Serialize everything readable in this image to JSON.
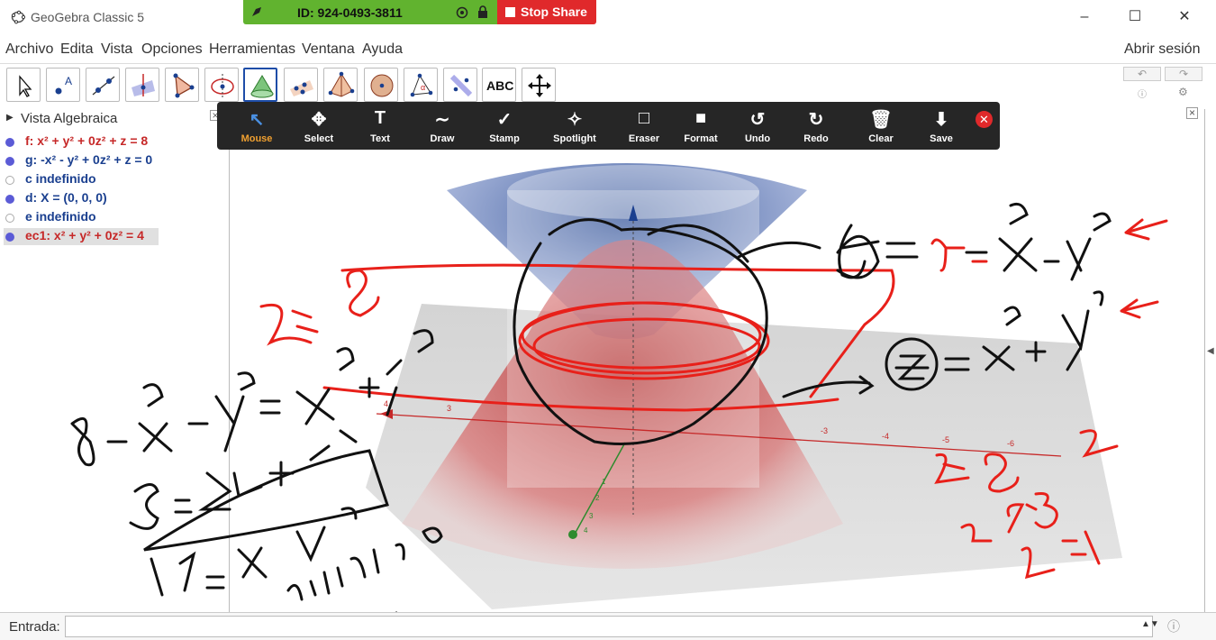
{
  "window": {
    "title": "GeoGebra Classic 5"
  },
  "zoom_share": {
    "meeting_id": "ID: 924-0493-3811",
    "stop_label": "Stop Share"
  },
  "menu": [
    "Archivo",
    "Edita",
    "Vista",
    "Opciones",
    "Herramientas",
    "Ventana",
    "Ayuda"
  ],
  "login": "Abrir sesión",
  "toolbar_icons": [
    "move-tool",
    "point-tool",
    "line-tool",
    "perpendicular-tool",
    "polygon-tool",
    "circle-tool",
    "cone-tool",
    "sphere-points-tool",
    "pyramid-tool",
    "sphere-tool",
    "angle-tool",
    "reflect-tool",
    "text-tool",
    "move-view-tool"
  ],
  "text_tool_label": "ABC",
  "algebra": {
    "title": "Vista Algebraica",
    "items": [
      {
        "text": "f: x² + y² + 0z² + z = 8",
        "color": "#c62828",
        "dot": "#5b5bd6"
      },
      {
        "text": "g: -x² - y² + 0z² + z = 0",
        "color": "#1a3f8f",
        "dot": "#5b5bd6"
      },
      {
        "text": "c indefinido",
        "color": "#1a3f8f",
        "dot": "none"
      },
      {
        "text": "d: X = (0, 0, 0)",
        "color": "#1a3f8f",
        "dot": "#5b5bd6"
      },
      {
        "text": "e indefinido",
        "color": "#1a3f8f",
        "dot": "none"
      },
      {
        "text": "ec1: x² + y² + 0z² = 4",
        "color": "#c62828",
        "dot": "#5b5bd6"
      }
    ]
  },
  "annotate_bar": {
    "tools": [
      "Mouse",
      "Select",
      "Text",
      "Draw",
      "Stamp",
      "Spotlight",
      "Eraser",
      "Format",
      "Undo",
      "Redo",
      "Clear",
      "Save"
    ]
  },
  "axis_labels": {
    "x_ticks": [
      "4",
      "3",
      "-3",
      "-4",
      "-5",
      "-6"
    ],
    "z_ticks": [
      "1",
      "2",
      "3",
      "4"
    ]
  },
  "input": {
    "label": "Entrada:"
  },
  "colors": {
    "accent_blue": "#1e4da8",
    "zoom_green": "#61b32f",
    "stop_red": "#e0292b",
    "ink_red": "#e8201a",
    "ink_black": "#111111"
  }
}
